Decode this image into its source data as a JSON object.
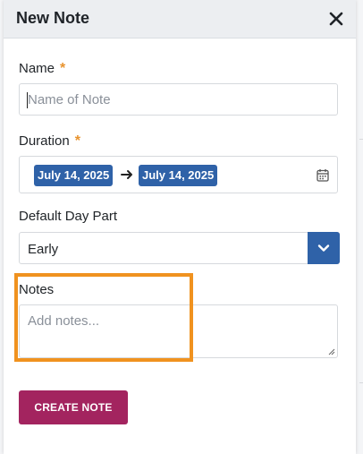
{
  "modal": {
    "title": "New Note",
    "close_icon": "close-icon"
  },
  "form": {
    "name": {
      "label": "Name",
      "required_marker": "*",
      "placeholder": "Name of Note",
      "value": ""
    },
    "duration": {
      "label": "Duration",
      "required_marker": "*",
      "start_date": "July 14, 2025",
      "end_date": "July 14, 2025",
      "arrow_icon": "arrow-right-icon",
      "calendar_icon": "calendar-icon"
    },
    "default_day_part": {
      "label": "Default Day Part",
      "selected": "Early",
      "dropdown_icon": "chevron-down-icon"
    },
    "notes": {
      "label": "Notes",
      "placeholder": "Add notes...",
      "value": ""
    },
    "submit_label": "CREATE NOTE"
  },
  "colors": {
    "accent_blue": "#2f62a8",
    "required": "#e8932e",
    "primary_button": "#a3245f",
    "highlight": "#f0921f",
    "header_bg": "#eceef1"
  }
}
